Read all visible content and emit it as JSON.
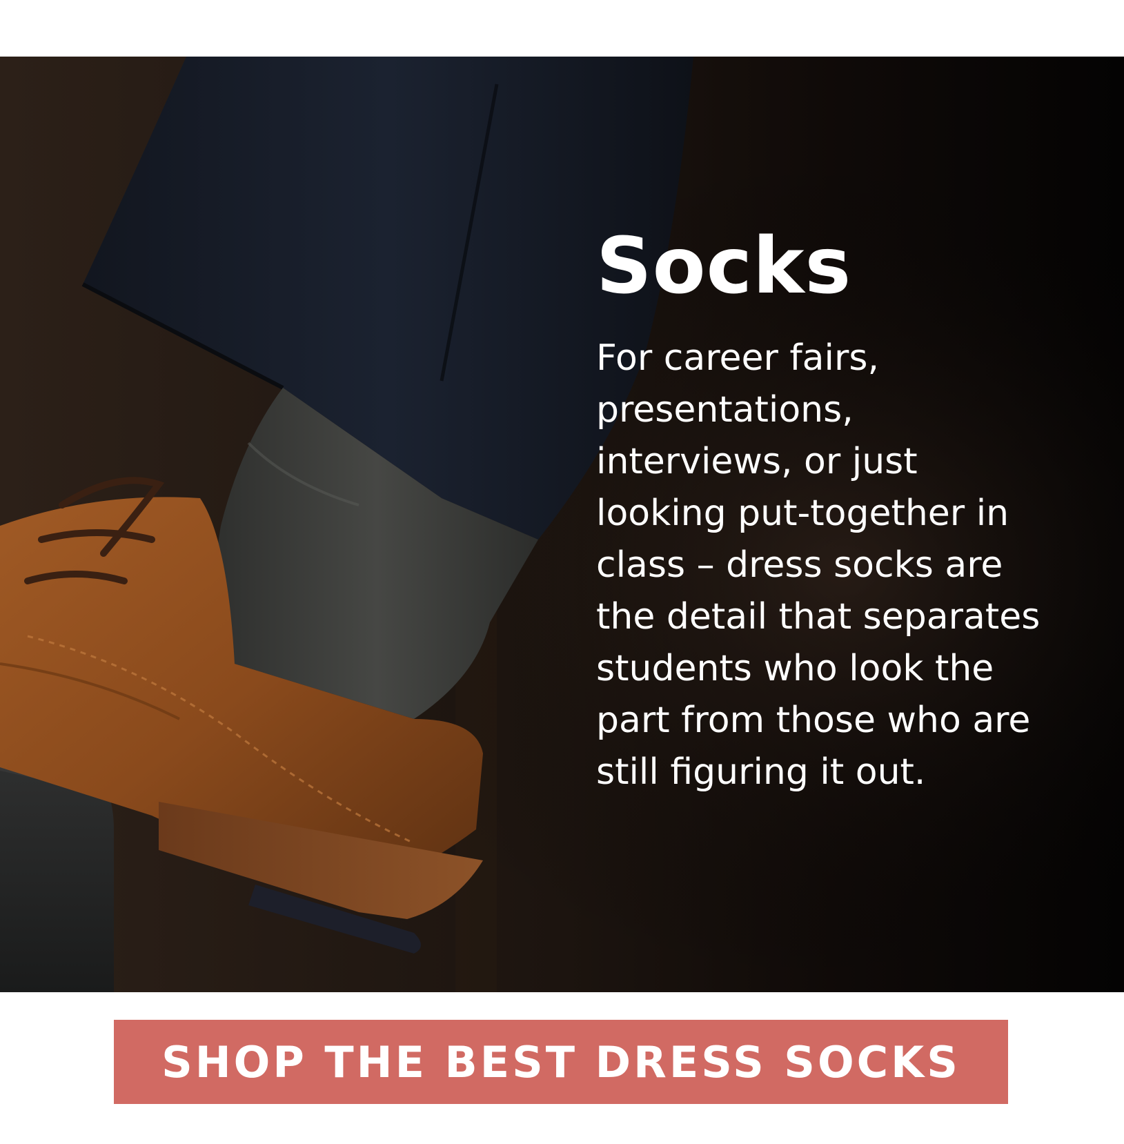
{
  "hero": {
    "title": "Socks",
    "body": "For career fairs,\npresentations,\ninterviews, or just\nlooking put-together in\nclass – dress socks are\nthe detail that separates\nstudents who look the\npart from those who are\nstill figuring it out.",
    "image_alt": "Brown suede lace-up dress shoe with grey dress sock and navy trouser hem"
  },
  "cta": {
    "label": "SHOP THE BEST DRESS SOCKS"
  },
  "colors": {
    "cta_background": "#d16a63",
    "hero_text": "#ffffff",
    "page_background": "#ffffff"
  }
}
